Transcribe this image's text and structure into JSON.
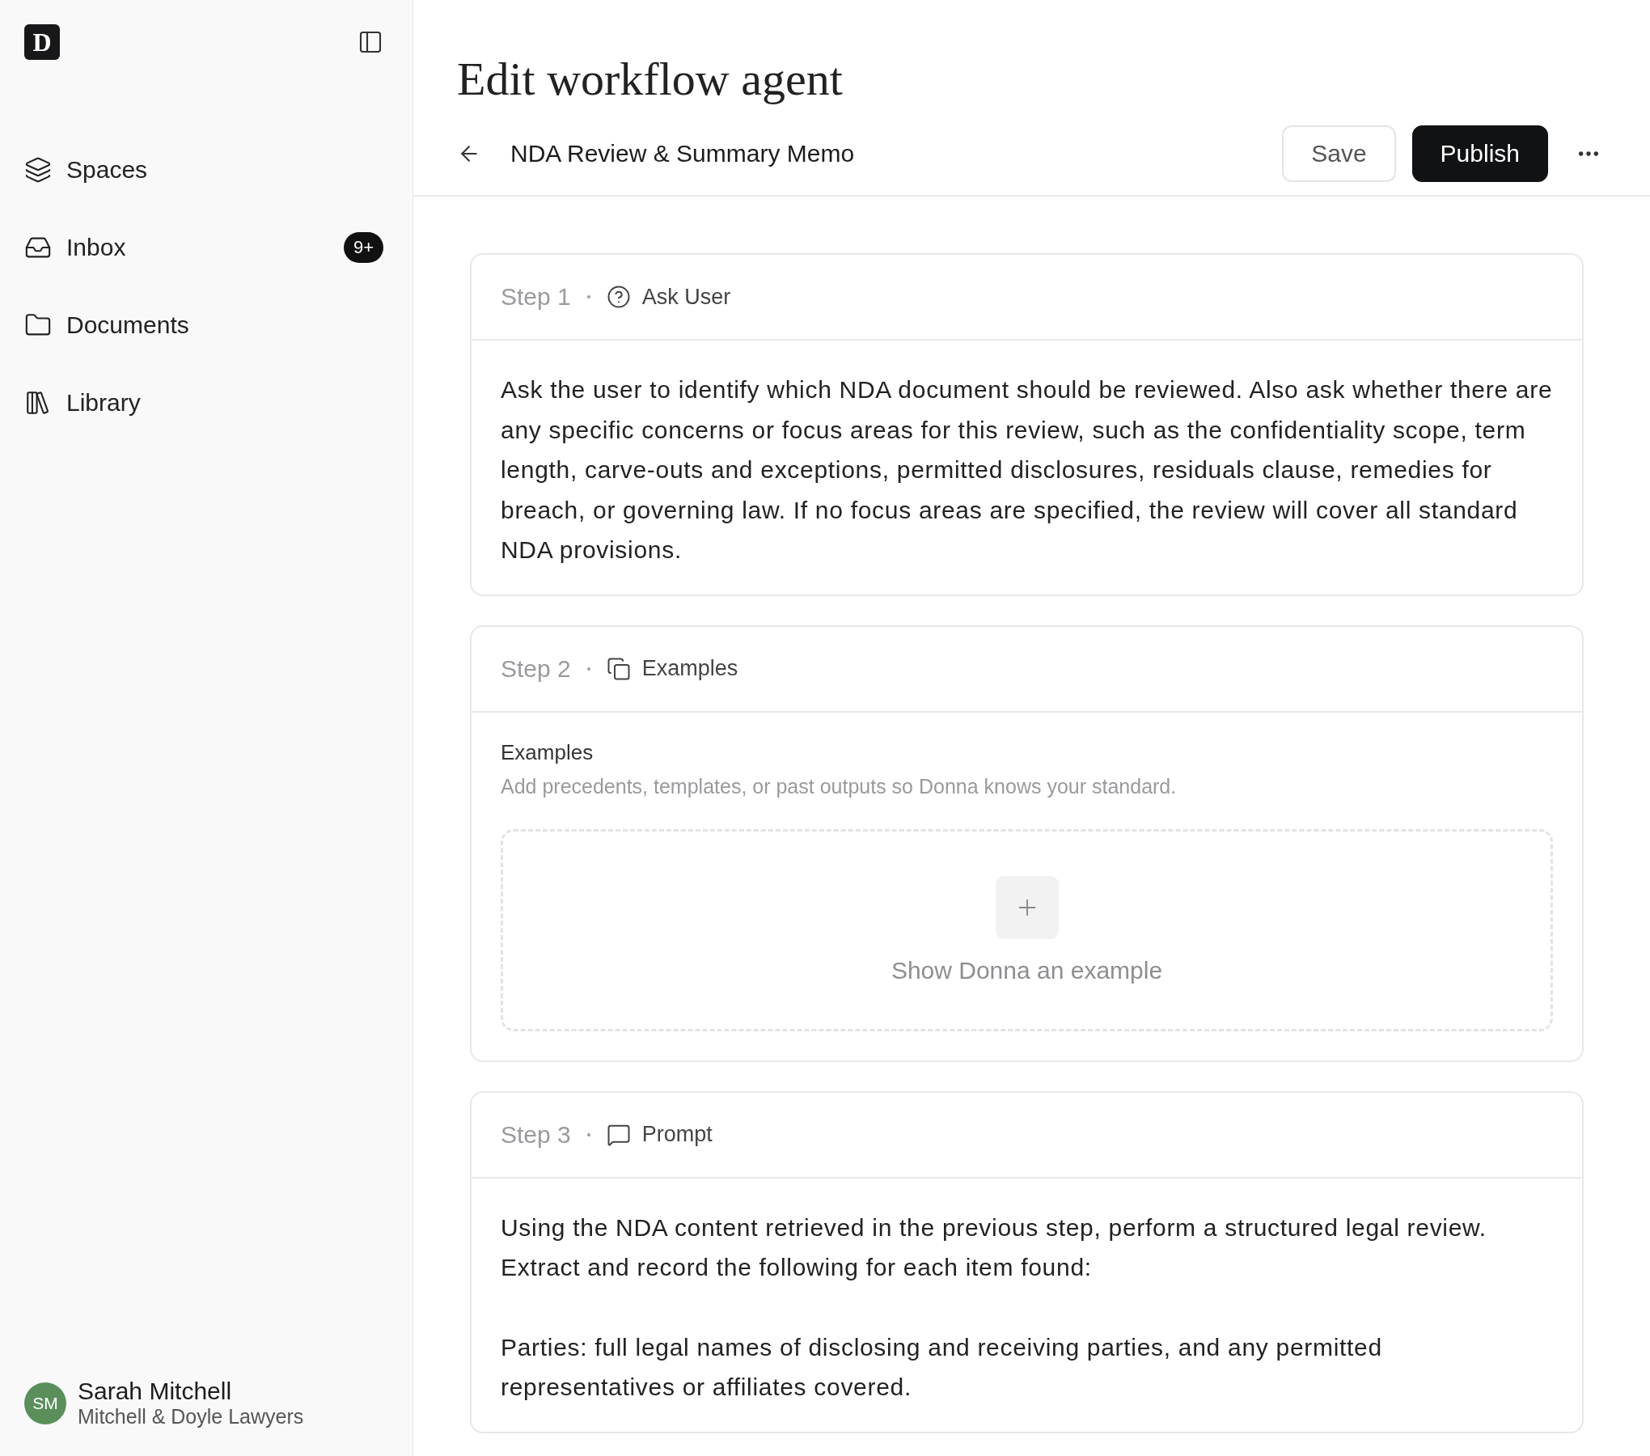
{
  "sidebar": {
    "logo": "D",
    "nav": [
      {
        "kind": "spaces",
        "label": "Spaces"
      },
      {
        "kind": "inbox",
        "label": "Inbox",
        "badge": "9+"
      },
      {
        "kind": "documents",
        "label": "Documents"
      },
      {
        "kind": "library",
        "label": "Library"
      }
    ],
    "user": {
      "initials": "SM",
      "name": "Sarah Mitchell",
      "org": "Mitchell & Doyle Lawyers",
      "color": "#5a8f5c"
    }
  },
  "header": {
    "title": "Edit workflow agent",
    "workflow_name": "NDA Review & Summary Memo",
    "buttons": [
      {
        "kind": "secondary",
        "label": "Save"
      },
      {
        "kind": "primary",
        "label": "Publish"
      }
    ]
  },
  "steps": [
    {
      "step": "Step 1",
      "kind": "ask",
      "type": "Ask User",
      "paragraphs": [
        "Ask the user to identify which NDA document should be reviewed. Also ask whether there are any specific concerns or focus areas for this review, such as the confidentiality scope, term length, carve-outs and exceptions, permitted disclosures, residuals clause, remedies for breach, or governing law. If no focus areas are specified, the review will cover all standard NDA provisions."
      ]
    },
    {
      "step": "Step 2",
      "kind": "examples",
      "type": "Examples",
      "section_title": "Examples",
      "section_hint": "Add precedents, templates, or past outputs so Donna knows your standard.",
      "dropzone_label": "Show Donna an example"
    },
    {
      "step": "Step 3",
      "kind": "prompt",
      "type": "Prompt",
      "paragraphs": [
        "Using the NDA content retrieved in the previous step, perform a structured legal review. Extract and record the following for each item found:",
        "Parties: full legal names of disclosing and receiving parties, and any permitted representatives or affiliates covered."
      ]
    }
  ]
}
